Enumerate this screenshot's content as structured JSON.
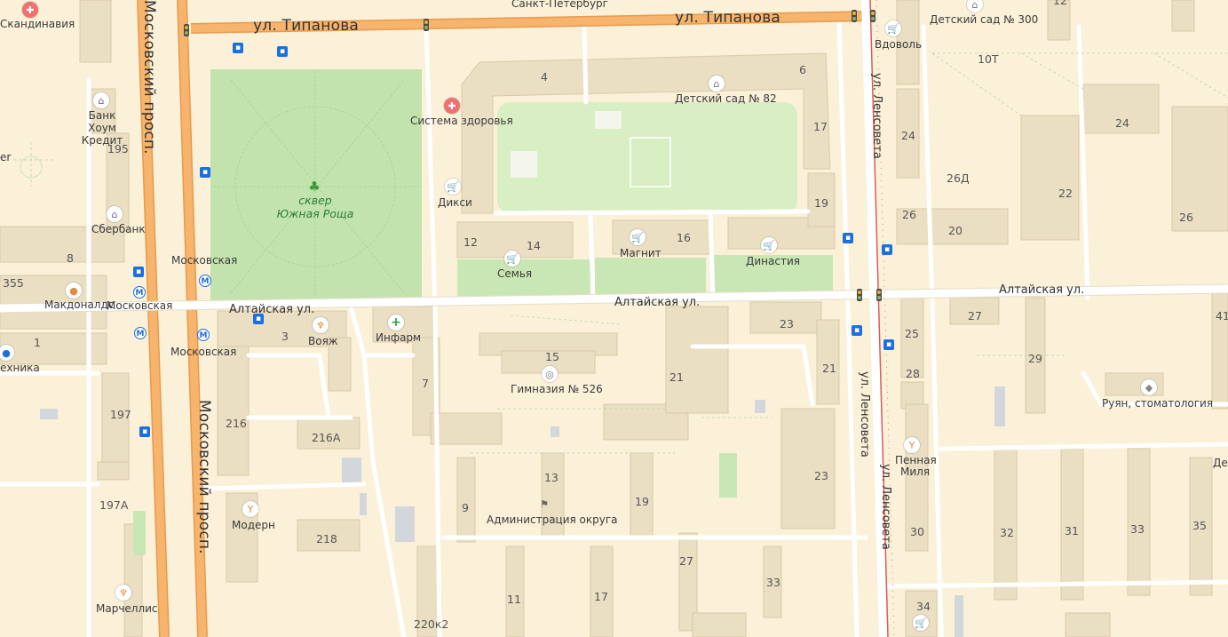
{
  "colors": {
    "background": "#fbf1d9",
    "building": "#eadfc3",
    "building_dark": "#dccfb0",
    "park": "#c2e3ad",
    "park_light": "#d8efc4",
    "major_road": "#f4a85c",
    "minor_road": "#ffffff",
    "railway": "#d65d5d",
    "transit": "#1d6fe0"
  },
  "streets": {
    "tipanova_1": "ул. Типанова",
    "tipanova_2": "ул. Типанова",
    "moskovsky_top": "Московский просп.",
    "moskovsky_main": "Московский просп.",
    "altaiskaya_1": "Алтайская ул.",
    "altaiskaya_2": "Алтайская ул.",
    "altaiskaya_3": "Алтайская ул.",
    "lensoveta_1": "ул. Ленсовета",
    "lensoveta_2": "ул. Ленсовета",
    "lensoveta_3": "ул. Ленсовета"
  },
  "park_label": {
    "line1": "сквер",
    "line2": "Южная Роща"
  },
  "pois": {
    "skandinavia": "Скандинавия",
    "spb": "Санкт-Петербург",
    "ds300": "Детский сад № 300",
    "vdovol": "Вдоволь",
    "bank_home": "Банк Хоум Кредит",
    "sberbank": "Сбербанк",
    "mcd": "Макдоналдс",
    "moskovskaya_metro_1": "Московская",
    "moskovskaya_metro_2": "Московская",
    "moskovskaya_stop": "Московская",
    "tekhnika": "ехника",
    "zdorovya": "Система здоровья",
    "ds82": "Детский сад № 82",
    "diksi": "Дикси",
    "semya": "Семья",
    "magnit": "Магнит",
    "dinastia": "Династия",
    "voyazh": "Вояж",
    "infarm": "Инфарм",
    "gymnasium": "Гимназия № 526",
    "admin": "Администрация округа",
    "modern": "Модерн",
    "marchellis": "Марчеллис",
    "pennaya_1": "Пенная",
    "pennaya_2": "Миля",
    "ruyan": "Руян, стоматология",
    "er": "er",
    "det": "Дет"
  },
  "house_numbers": {
    "h12top": "12",
    "h10T": "10Т",
    "h4": "4",
    "h6": "6",
    "h195": "195",
    "h17a": "17",
    "h24a": "24",
    "h24b": "24",
    "h26D": "26Д",
    "h22": "22",
    "h19a": "19",
    "h26a": "26",
    "h20": "20",
    "h26b": "26",
    "h8": "8",
    "h355": "355",
    "h12": "12",
    "h14": "14",
    "h16": "16",
    "h1": "1",
    "h3": "3",
    "h23a": "23",
    "h27a": "27",
    "h41": "41",
    "h25": "25",
    "h15": "15",
    "h29": "29",
    "h7": "7",
    "h21a": "21",
    "h21b": "21",
    "h28": "28",
    "h197": "197",
    "h216": "216",
    "h216A": "216А",
    "h13": "13",
    "h23b": "23",
    "h197A": "197А",
    "h9": "9",
    "h19b": "19",
    "h218": "218",
    "h30": "30",
    "h32": "32",
    "h31": "31",
    "h33a": "33",
    "h35": "35",
    "h27b": "27",
    "h11": "11",
    "h17b": "17",
    "h33b": "33",
    "h220k2": "220к2",
    "h34": "34"
  },
  "icons": [
    "medical-cross-icon",
    "shopping-cart-icon",
    "bank-icon",
    "burger-icon",
    "metro-icon",
    "bus-stop-icon",
    "traffic-light-icon",
    "pharmacy-cross-icon",
    "restaurant-icon",
    "bar-glass-icon",
    "school-icon",
    "flag-icon",
    "tooth-icon",
    "tree-icon",
    "kindergarten-icon"
  ]
}
